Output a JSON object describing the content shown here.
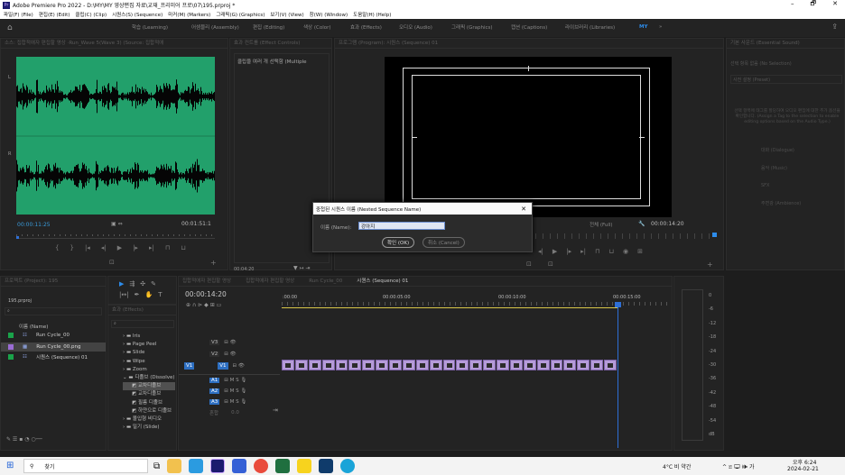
{
  "window": {
    "title": "Adobe Premiere Pro 2022 - D:\\MY\\MY 영상편집 자료\\교재_프리미어 프로\\07\\195.prproj *",
    "min_glyph": "–",
    "max_glyph": "🗗",
    "close_glyph": "✕"
  },
  "menu": [
    "파일(F) (File)",
    "편집(E) (Edit)",
    "클립(C) (Clip)",
    "시퀀스(S) (Sequence)",
    "마커(M) (Markers)",
    "그래픽(G) (Graphics)",
    "보기(V) (View)",
    "창(W) (Window)",
    "도움말(H) (Help)"
  ],
  "workspaces": [
    "학습 (Learning)",
    "어셈블리 (Assembly)",
    "편집 (Editing)",
    "색상 (Color)",
    "효과 (Effects)",
    "오디오 (Audio)",
    "그래픽 (Graphics)",
    "캡션 (Captions)",
    "라이브러리 (Libraries)",
    "MY"
  ],
  "workspaces_more": "»",
  "source": {
    "tab": "소스: 집합적애자 편집할 영상 ·Run_Wave 5(Wave 3) (Source: 집합적애",
    "more": "≡",
    "tc_left": "00:00:11:25",
    "tc_right": "00:01:51:1",
    "ruler_l": "L",
    "ruler_r": "R"
  },
  "effect_controls": {
    "tab": "효과 컨트롤 (Effect Controls)",
    "message": "클립을 여러 개 선택함 (Multiple",
    "time": "00:04:20"
  },
  "program": {
    "tab": "프로그램 (Program): 시퀀스 (Sequence) 01",
    "more": "≡",
    "fit": "전체 (Full)",
    "tc": "00:00:14:20"
  },
  "essential_sound": {
    "tab": "기본 사운드 (Essential Sound)",
    "more": "»",
    "no_selection": "선택 항목 없음 (No Selection)",
    "preset": "사전 설정 (Preset)",
    "message": "선택 항목에 태그를 할당하여 오디오 편집에 대한 추가 옵션을 확인합니다. (Assign a Tag to the selection to enable editing options based on the Audio Type.)",
    "items": [
      "대화 (Dialogue)",
      "음악 (Music)",
      "SFX",
      "주변광 (Ambience)"
    ]
  },
  "dialog": {
    "title": "중첩된 시퀀스 이름 (Nested Sequence Name)",
    "close": "✕",
    "name_label": "이름 (Name):",
    "name_value": "강아지",
    "ok": "확인 (OK)",
    "cancel": "취소 (Cancel)"
  },
  "project": {
    "tab": "프로젝트 (Project): 195",
    "file": "195.prproj",
    "header": "이름 (Name)",
    "items": [
      {
        "name": "Run Cycle_00",
        "color": "#1aa34a"
      },
      {
        "name": "Run Cycle_00.png",
        "color": "#9a6cd4"
      },
      {
        "name": "시퀀스 (Sequence) 01",
        "color": "#1aa34a"
      }
    ]
  },
  "effects": {
    "tab": "효과 (Effects)",
    "folders": [
      "Iris",
      "Page Peel",
      "Slide",
      "Wipe",
      "Zoom",
      "디졸브 (Dissolve)",
      "몰입형 비디오",
      "밀기 (Slide)"
    ],
    "subitems": [
      "교차디졸브",
      "교차디졸브",
      "필름 디졸브",
      "하얀으로 디졸브"
    ]
  },
  "timeline": {
    "tabs": [
      "집합적애자 편집할 영상",
      "집합적애자 편집할 영상",
      "Run Cycle_00",
      "시퀀스 (Sequence) 01"
    ],
    "tc": "00:00:14:20",
    "ruler": [
      ":00:00",
      "00:00:05:00",
      "00:00:10:00",
      "00:00:15:00"
    ],
    "tracks_v": [
      "V3",
      "V2",
      "V1"
    ],
    "tracks_a": [
      "A1",
      "A2",
      "A3"
    ],
    "master": "혼합",
    "master_val": "0.0"
  },
  "meter": {
    "labels": [
      "0",
      "-6",
      "-12",
      "-18",
      "-24",
      "-30",
      "-36",
      "-42",
      "-48",
      "-54",
      "dB"
    ]
  },
  "taskbar": {
    "search": "찾기",
    "weather": "4°C 비 약간",
    "time": "오후 6:24",
    "date": "2024-02-21",
    "tray": "^ 🗈 🖵 🕪 가"
  },
  "colors": {
    "accent": "#2d8ceb",
    "timecode": "#3a9ad9",
    "clip": "#b59bd9",
    "waveform_bg": "#22a06b",
    "playhead": "#2e6fd6"
  }
}
